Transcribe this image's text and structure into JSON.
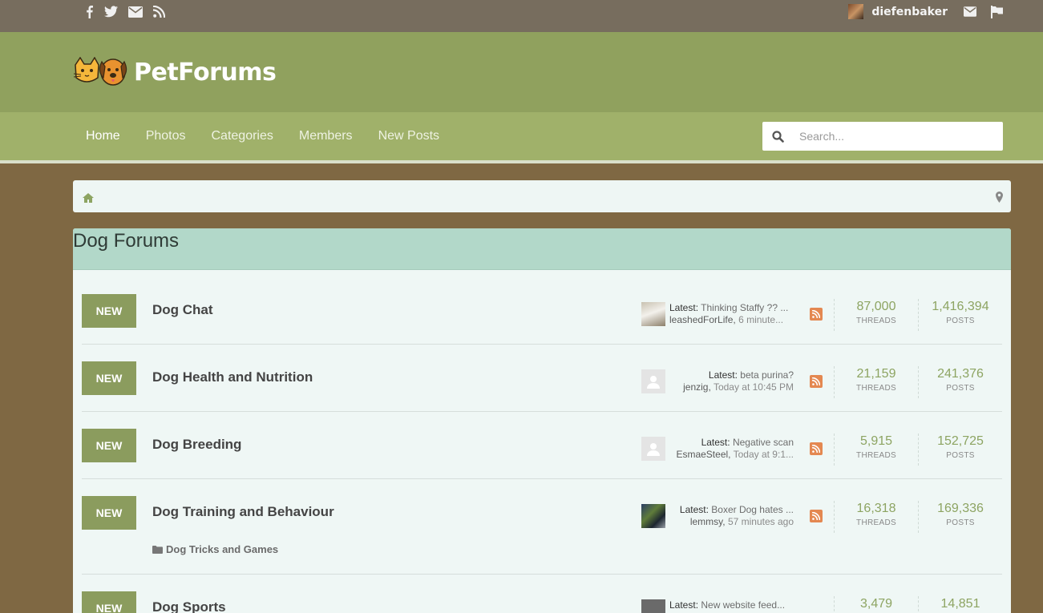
{
  "topbar": {
    "social_icons": [
      "facebook-icon",
      "twitter-icon",
      "mail-icon",
      "rss-icon"
    ],
    "username": "diefenbaker",
    "user_icons": [
      "mail-icon",
      "flag-icon"
    ]
  },
  "header": {
    "logo_text": "PetForums"
  },
  "nav": {
    "items": [
      "Home",
      "Photos",
      "Categories",
      "Members",
      "New Posts"
    ],
    "active": "Home",
    "search_placeholder": "Search..."
  },
  "section": {
    "title": "Dog Forums"
  },
  "forums": [
    {
      "badge": "NEW",
      "title": "Dog Chat",
      "latest_label": "Latest:",
      "latest_thread": "Thinking Staffy ?? ...",
      "latest_user": "leashedForLife",
      "latest_time": "6 minute...",
      "threads": "87,000",
      "posts": "1,416,394",
      "threads_label": "THREADS",
      "posts_label": "POSTS"
    },
    {
      "badge": "NEW",
      "title": "Dog Health and Nutrition",
      "latest_label": "Latest:",
      "latest_thread": "beta purina?",
      "latest_user": "jenzig",
      "latest_time": "Today at 10:45 PM",
      "threads": "21,159",
      "posts": "241,376",
      "threads_label": "THREADS",
      "posts_label": "POSTS"
    },
    {
      "badge": "NEW",
      "title": "Dog Breeding",
      "latest_label": "Latest:",
      "latest_thread": "Negative scan",
      "latest_user": "EsmaeSteel",
      "latest_time": "Today at 9:1...",
      "threads": "5,915",
      "posts": "152,725",
      "threads_label": "THREADS",
      "posts_label": "POSTS"
    },
    {
      "badge": "NEW",
      "title": "Dog Training and Behaviour",
      "latest_label": "Latest:",
      "latest_thread": "Boxer Dog hates ...",
      "latest_user": "lemmsy",
      "latest_time": "57 minutes ago",
      "threads": "16,318",
      "posts": "169,336",
      "threads_label": "THREADS",
      "posts_label": "POSTS",
      "subforum": "Dog Tricks and Games"
    },
    {
      "badge": "NEW",
      "title": "Dog Sports",
      "latest_label": "Latest:",
      "latest_thread": "New website feed...",
      "threads": "3,479",
      "posts": "14,851"
    }
  ],
  "colors": {
    "background": "#7f6843",
    "topbar": "#776d5e",
    "header": "#90a15e",
    "nav": "#a0b16a",
    "section_title": "#b2d8c9",
    "badge": "#8b9c5e",
    "stat_number": "#8da462",
    "rss": "#e48851"
  }
}
